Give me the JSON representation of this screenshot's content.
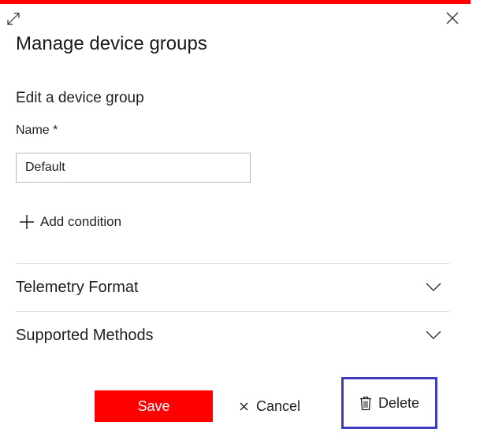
{
  "colors": {
    "accent": "#ff0000",
    "highlight_border": "#3d3dbd",
    "divider": "#d6d6d6"
  },
  "header": {
    "expand_icon": "expand-icon",
    "close_icon": "close-icon",
    "title": "Manage device groups"
  },
  "form": {
    "subtitle": "Edit a device group",
    "name_label": "Name *",
    "name_value": "Default",
    "add_condition_icon": "plus-icon",
    "add_condition_label": "Add condition"
  },
  "sections": [
    {
      "label": "Telemetry Format",
      "icon": "chevron-down-icon"
    },
    {
      "label": "Supported Methods",
      "icon": "chevron-down-icon"
    }
  ],
  "footer": {
    "save_label": "Save",
    "cancel_label": "Cancel",
    "cancel_icon": "x-icon",
    "delete_label": "Delete",
    "delete_icon": "trash-icon"
  }
}
